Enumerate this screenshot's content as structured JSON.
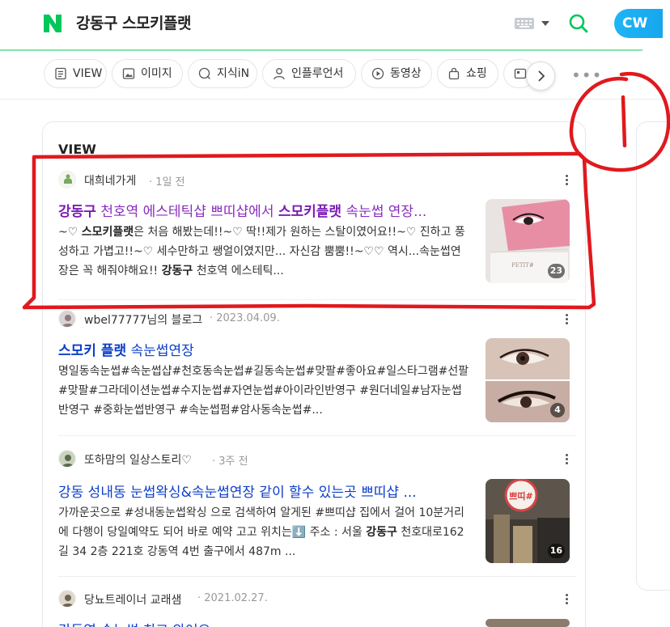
{
  "header": {
    "query": "강동구 스모키플랫",
    "avatar_text": "CW",
    "accent": "#03c75a"
  },
  "tabs": [
    {
      "label": "VIEW",
      "icon": "document-icon"
    },
    {
      "label": "이미지",
      "icon": "image-icon"
    },
    {
      "label": "지식iN",
      "icon": "qna-icon"
    },
    {
      "label": "인플루언서",
      "icon": "person-icon"
    },
    {
      "label": "동영상",
      "icon": "play-icon"
    },
    {
      "label": "쇼핑",
      "icon": "bag-icon"
    }
  ],
  "section": {
    "title": "VIEW"
  },
  "results": [
    {
      "source": "대희네가게",
      "date": "1일 전",
      "title_parts": [
        "강동구",
        " 천호역 에스테틱샵 쁘띠샵에서 ",
        "스모키플랫",
        " 속눈썹 연장..."
      ],
      "desc_html_parts": [
        "~♡ ",
        "스모키플랫",
        "은 처음 해봤는데!!~♡ 딱!!제가 원하는 스탈이였어요!!~♡ 진하고 풍성하고 가볍고!!~♡ 세수만하고 쌩얼이였지만... 자신감 뿜뿜!!~♡♡ 역시...속눈썹연장은 꼭 해줘야해요!! ",
        "강동구",
        " 천호역 에스테틱..."
      ],
      "thumb_count": "23"
    },
    {
      "source": "wbel77777님의 블로그",
      "date": "2023.04.09.",
      "title": "스모키 플랫 속눈썹연장",
      "title_bold": "스모키 플랫",
      "title_rest": " 속눈썹연장",
      "desc": "명일동속눈썹#속눈썹샵#천호동속눈썹#길동속눈썹#맞팔#좋아요#일스타그램#선팔#맞팔#그라데이션눈썹#수지눈썹#자연눈썹#아이라인반영구 #원더네일#남자눈썹반영구 #중화눈썹반영구 #속눈썹펌#암사동속눈썹#...",
      "thumb_count": "4"
    },
    {
      "source": "또하맘의 일상스토리♡",
      "date": "3주 전",
      "title": "강동 성내동 눈썹왁싱&속눈썹연장 같이 할수 있는곳 쁘띠샵 ...",
      "desc_parts": [
        "가까운곳으로 #성내동눈썹왁싱 으로 검색하여 알게된 #쁘띠샵 집에서 걸어 10분거리에 다행이 당일예약도 되어 바로 예약 고고 위치는⬇️ 주소 : 서울 ",
        "강동구",
        " 천호대로162길 34 2층 221호 강동역 4번 출구에서 487m ..."
      ],
      "thumb_count": "16",
      "sign_text": "쁘띠#"
    },
    {
      "source": "당뇨트레이너 교래샘",
      "date": "2021.02.27.",
      "title": "강동역 속눈썹 최고 와어오"
    }
  ],
  "annotation": {
    "label": "1",
    "color": "#e0191e"
  },
  "thumb1_text": "PETIT#"
}
